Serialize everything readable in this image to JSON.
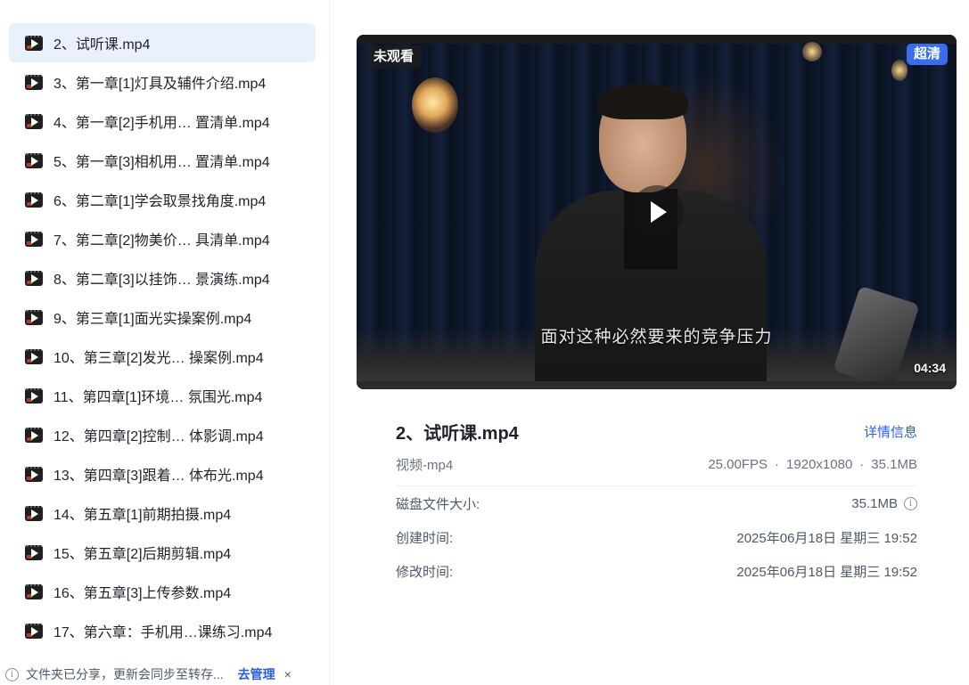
{
  "sidebar": {
    "items": [
      {
        "label": "2、试听课.mp4",
        "active": true
      },
      {
        "label": "3、第一章[1]灯具及辅件介绍.mp4"
      },
      {
        "label": "4、第一章[2]手机用… 置清单.mp4"
      },
      {
        "label": "5、第一章[3]相机用… 置清单.mp4"
      },
      {
        "label": "6、第二章[1]学会取景找角度.mp4"
      },
      {
        "label": "7、第二章[2]物美价… 具清单.mp4"
      },
      {
        "label": "8、第二章[3]以挂饰… 景演练.mp4"
      },
      {
        "label": "9、第三章[1]面光实操案例.mp4"
      },
      {
        "label": "10、第三章[2]发光…  操案例.mp4"
      },
      {
        "label": "11、第四章[1]环境…  氛围光.mp4"
      },
      {
        "label": "12、第四章[2]控制…  体影调.mp4"
      },
      {
        "label": "13、第四章[3]跟着…  体布光.mp4"
      },
      {
        "label": "14、第五章[1]前期拍摄.mp4"
      },
      {
        "label": "15、第五章[2]后期剪辑.mp4"
      },
      {
        "label": "16、第五章[3]上传参数.mp4"
      },
      {
        "label": "17、第六章：手机用…课练习.mp4"
      }
    ],
    "notice": {
      "icon": "info-icon",
      "text": "文件夹已分享，更新会同步至转存...",
      "link": "去管理",
      "close": "×"
    }
  },
  "player": {
    "status_badge": "未观看",
    "quality_badge": "超清",
    "subtitle": "面对这种必然要来的竞争压力",
    "duration": "04:34",
    "progress": 0,
    "accent": "#3a6cf0"
  },
  "info": {
    "title": "2、试听课.mp4",
    "detail_link": "详情信息",
    "type": "视频-mp4",
    "fps": "25.00FPS",
    "resolution": "1920x1080",
    "size": "35.1MB",
    "separator": "·",
    "props": [
      {
        "label": "磁盘文件大小:",
        "value": "35.1MB",
        "has_info": true
      },
      {
        "label": "创建时间:",
        "value": "2025年06月18日 星期三 19:52"
      },
      {
        "label": "修改时间:",
        "value": "2025年06月18日 星期三 19:52"
      }
    ]
  }
}
